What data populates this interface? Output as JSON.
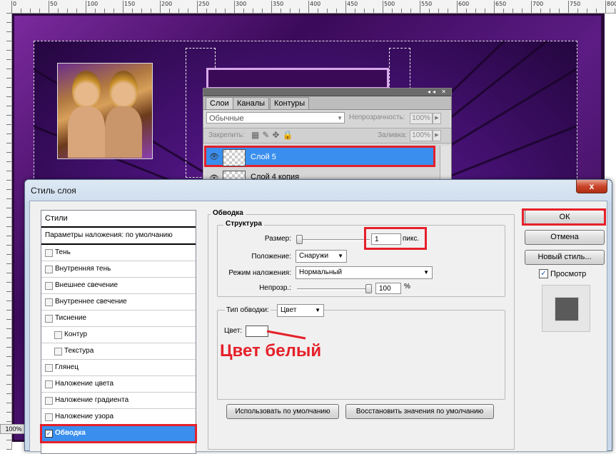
{
  "canvas": {
    "ruler_top_numbers": [
      "0",
      "50",
      "100",
      "150",
      "200",
      "250",
      "300",
      "350",
      "400",
      "450",
      "500",
      "550",
      "600",
      "650",
      "700",
      "750",
      "800"
    ],
    "zoom": "100%"
  },
  "layers_panel": {
    "tabs": [
      "Слои",
      "Каналы",
      "Контуры"
    ],
    "blend_mode": "Обычные",
    "opacity_label": "Непрозрачность:",
    "opacity_value": "100%",
    "lock_label": "Закрепить:",
    "fill_label": "Заливка:",
    "fill_value": "100%",
    "layers": [
      {
        "name": "Слой 5",
        "selected": true
      },
      {
        "name": "Слой 4 копия",
        "selected": false
      }
    ]
  },
  "dialog": {
    "title": "Стиль слоя",
    "close_label": "x",
    "styles_header": "Стили",
    "blend_options": "Параметры наложения: по умолчанию",
    "style_items": [
      {
        "label": "Тень",
        "checked": false,
        "sub": false
      },
      {
        "label": "Внутренняя тень",
        "checked": false,
        "sub": false
      },
      {
        "label": "Внешнее свечение",
        "checked": false,
        "sub": false
      },
      {
        "label": "Внутреннее свечение",
        "checked": false,
        "sub": false
      },
      {
        "label": "Тиснение",
        "checked": false,
        "sub": false
      },
      {
        "label": "Контур",
        "checked": false,
        "sub": true
      },
      {
        "label": "Текстура",
        "checked": false,
        "sub": true
      },
      {
        "label": "Глянец",
        "checked": false,
        "sub": false
      },
      {
        "label": "Наложение цвета",
        "checked": false,
        "sub": false
      },
      {
        "label": "Наложение градиента",
        "checked": false,
        "sub": false
      },
      {
        "label": "Наложение узора",
        "checked": false,
        "sub": false
      },
      {
        "label": "Обводка",
        "checked": true,
        "sub": false,
        "selected": true
      }
    ],
    "stroke": {
      "group_title": "Обводка",
      "structure_title": "Структура",
      "size_label": "Размер:",
      "size_value": "1",
      "size_unit": "пикс.",
      "position_label": "Положение:",
      "position_value": "Снаружи",
      "blend_label": "Режим наложения:",
      "blend_value": "Нормальный",
      "opacity_label": "Непрозр.:",
      "opacity_value": "100",
      "opacity_unit": "%",
      "fill_type_label": "Тип обводки:",
      "fill_type_value": "Цвет",
      "color_label": "Цвет:",
      "color_value": "#ffffff",
      "annotation": "Цвет белый",
      "default_btn": "Использовать по умолчанию",
      "reset_btn": "Восстановить значения по умолчанию"
    },
    "ok": "ОК",
    "cancel": "Отмена",
    "new_style": "Новый стиль...",
    "preview_label": "Просмотр",
    "preview_checked": true
  },
  "colors": {
    "highlight_red": "#e5202a",
    "selection_blue": "#3a8fee",
    "artwork_purple": "#5c1c84"
  }
}
